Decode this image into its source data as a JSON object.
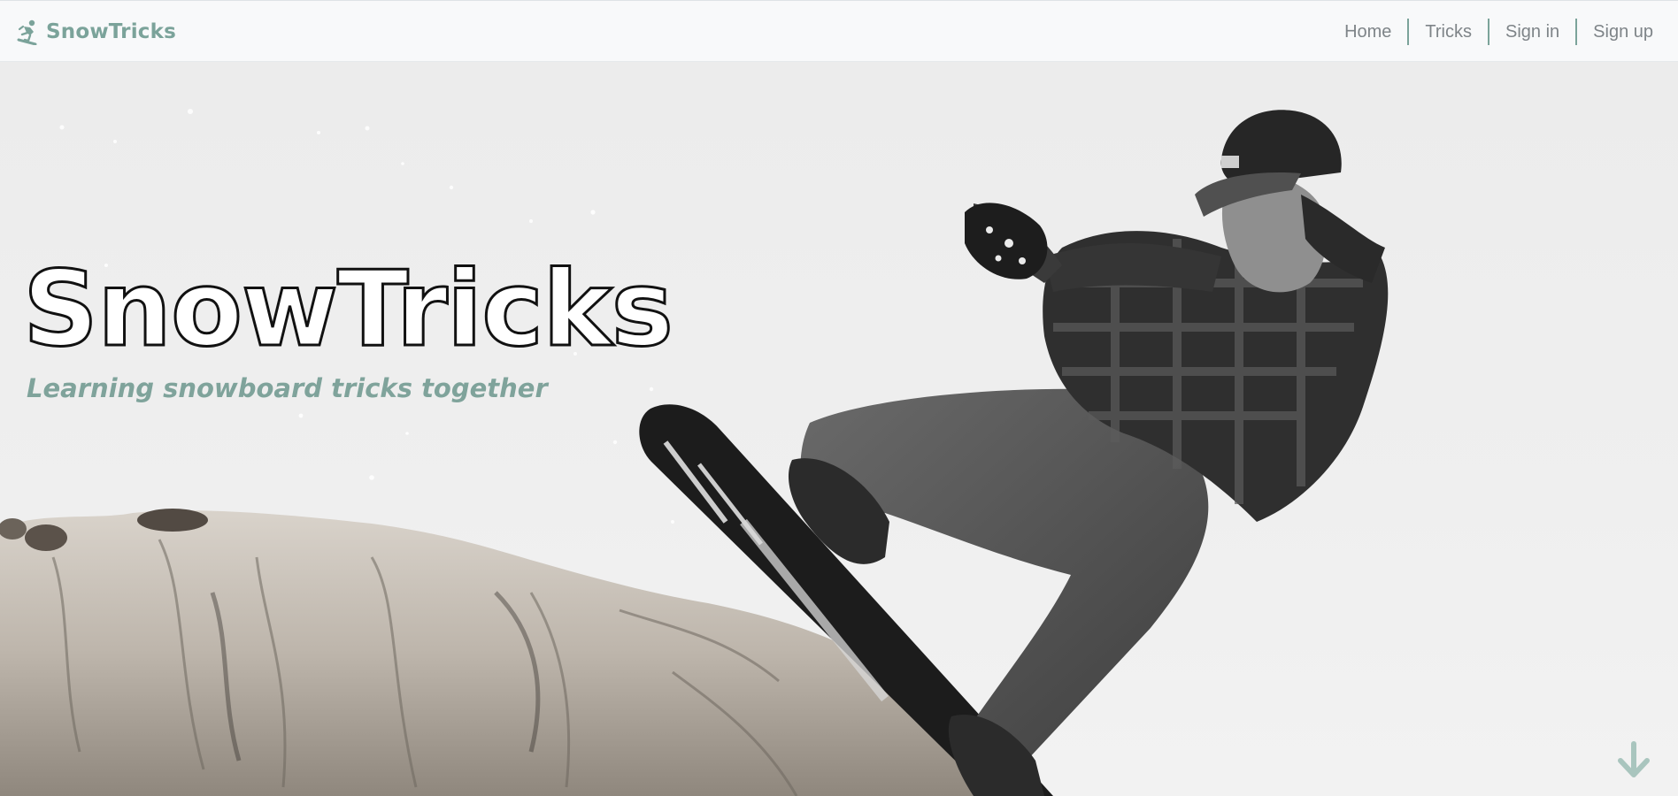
{
  "navbar": {
    "brand_icon": "snowboarder-icon",
    "brand_text": "SnowTricks",
    "links": [
      {
        "label": "Home"
      },
      {
        "label": "Tricks"
      },
      {
        "label": "Sign in"
      },
      {
        "label": "Sign up"
      }
    ]
  },
  "hero": {
    "title": "SnowTricks",
    "subtitle": "Learning snowboard tricks together",
    "image_description_icon": "snowboarder-on-rock-photo",
    "scroll_icon": "arrow-down-icon"
  },
  "colors": {
    "accent": "#7ba39a",
    "navbar_bg": "#f8f9fa",
    "nav_text": "#7e8488",
    "title_stroke": "#111111"
  }
}
